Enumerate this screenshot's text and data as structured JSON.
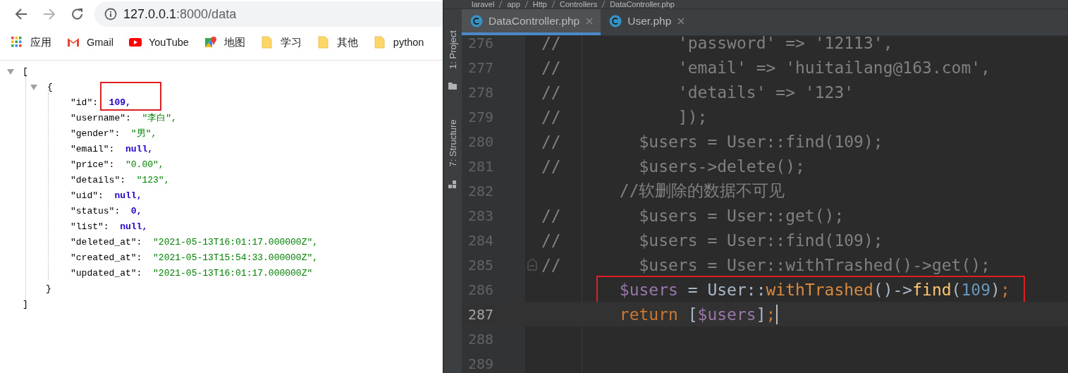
{
  "browser": {
    "address": {
      "host": "127.0.0.1",
      "path": ":8000/data"
    },
    "bookmarks": [
      {
        "kind": "apps",
        "label": "应用"
      },
      {
        "kind": "mail",
        "label": "Gmail"
      },
      {
        "kind": "video",
        "label": "YouTube"
      },
      {
        "kind": "map",
        "label": "地图"
      },
      {
        "kind": "folder",
        "label": "学习"
      },
      {
        "kind": "folder",
        "label": "其他"
      },
      {
        "kind": "folder",
        "label": "python"
      }
    ],
    "json_viewer": {
      "expanded": true,
      "open": "[",
      "close": "]",
      "object": {
        "expanded": true,
        "open": "{",
        "close": "}",
        "fields": [
          {
            "key": "\"id\":",
            "value": "109,",
            "kind": "number",
            "highlighted": true
          },
          {
            "key": "\"username\":",
            "value": "\"李白\",",
            "kind": "string",
            "highlighted": false
          },
          {
            "key": "\"gender\":",
            "value": "\"男\",",
            "kind": "string",
            "highlighted": false
          },
          {
            "key": "\"email\":",
            "value": "null,",
            "kind": "null",
            "highlighted": false
          },
          {
            "key": "\"price\":",
            "value": "\"0.00\",",
            "kind": "string",
            "highlighted": false
          },
          {
            "key": "\"details\":",
            "value": "\"123\",",
            "kind": "string",
            "highlighted": false
          },
          {
            "key": "\"uid\":",
            "value": "null,",
            "kind": "null",
            "highlighted": false
          },
          {
            "key": "\"status\":",
            "value": "0,",
            "kind": "number",
            "highlighted": false
          },
          {
            "key": "\"list\":",
            "value": "null,",
            "kind": "null",
            "highlighted": false
          },
          {
            "key": "\"deleted_at\":",
            "value": "\"2021-05-13T16:01:17.000000Z\",",
            "kind": "string",
            "highlighted": false
          },
          {
            "key": "\"created_at\":",
            "value": "\"2021-05-13T15:54:33.000000Z\",",
            "kind": "string",
            "highlighted": false
          },
          {
            "key": "\"updated_at\":",
            "value": "\"2021-05-13T16:01:17.000000Z\"",
            "kind": "string",
            "highlighted": false
          }
        ]
      }
    }
  },
  "ide": {
    "breadcrumb": [
      "laravel",
      "app",
      "Http",
      "Controllers",
      "DataController.php"
    ],
    "tool_windows": [
      "1: Project",
      "7: Structure"
    ],
    "tabs": [
      {
        "label": "DataController.php",
        "selected": true
      },
      {
        "label": "User.php",
        "selected": false
      }
    ],
    "lines": [
      {
        "number": "276",
        "current": false,
        "highlighted": false,
        "fold": false,
        "tokens": [
          {
            "kind": "comment",
            "text": "//            'password' => '12113',"
          }
        ]
      },
      {
        "number": "277",
        "current": false,
        "highlighted": false,
        "fold": false,
        "tokens": [
          {
            "kind": "comment",
            "text": "//            'email' => 'huitailang@163.com',"
          }
        ]
      },
      {
        "number": "278",
        "current": false,
        "highlighted": false,
        "fold": false,
        "tokens": [
          {
            "kind": "comment",
            "text": "//            'details' => '123'"
          }
        ]
      },
      {
        "number": "279",
        "current": false,
        "highlighted": false,
        "fold": false,
        "tokens": [
          {
            "kind": "comment",
            "text": "//            ]);"
          }
        ]
      },
      {
        "number": "280",
        "current": false,
        "highlighted": false,
        "fold": false,
        "tokens": [
          {
            "kind": "comment",
            "text": "//        $users = User::find(109);"
          }
        ]
      },
      {
        "number": "281",
        "current": false,
        "highlighted": false,
        "fold": false,
        "tokens": [
          {
            "kind": "comment",
            "text": "//        $users->delete();"
          }
        ]
      },
      {
        "number": "282",
        "current": false,
        "highlighted": false,
        "fold": false,
        "tokens": [
          {
            "kind": "comment",
            "text": "        //软删除的数据不可见"
          }
        ]
      },
      {
        "number": "283",
        "current": false,
        "highlighted": false,
        "fold": false,
        "tokens": [
          {
            "kind": "comment",
            "text": "//        $users = User::get();"
          }
        ]
      },
      {
        "number": "284",
        "current": false,
        "highlighted": false,
        "fold": false,
        "tokens": [
          {
            "kind": "comment",
            "text": "//        $users = User::find(109);"
          }
        ]
      },
      {
        "number": "285",
        "current": false,
        "highlighted": false,
        "fold": true,
        "tokens": [
          {
            "kind": "comment",
            "text": "//        $users = User::withTrashed()->get();"
          }
        ]
      },
      {
        "number": "286",
        "current": false,
        "highlighted": true,
        "fold": false,
        "tokens": [
          {
            "kind": "var",
            "text": "        $users"
          },
          {
            "kind": "plain",
            "text": " = User::"
          },
          {
            "kind": "method",
            "text": "withTrashed"
          },
          {
            "kind": "plain",
            "text": "()->"
          },
          {
            "kind": "call",
            "text": "find"
          },
          {
            "kind": "plain",
            "text": "("
          },
          {
            "kind": "number",
            "text": "109"
          },
          {
            "kind": "plain",
            "text": ")"
          },
          {
            "kind": "keyword",
            "text": ";"
          }
        ]
      },
      {
        "number": "287",
        "current": true,
        "highlighted": false,
        "fold": false,
        "tokens": [
          {
            "kind": "keyword",
            "text": "        return"
          },
          {
            "kind": "plain",
            "text": " ["
          },
          {
            "kind": "var",
            "text": "$users"
          },
          {
            "kind": "plain",
            "text": "]"
          },
          {
            "kind": "keyword",
            "text": ";"
          }
        ]
      },
      {
        "number": "288",
        "current": false,
        "highlighted": false,
        "fold": false
      },
      {
        "number": "289",
        "current": false,
        "highlighted": false,
        "fold": false
      }
    ]
  }
}
